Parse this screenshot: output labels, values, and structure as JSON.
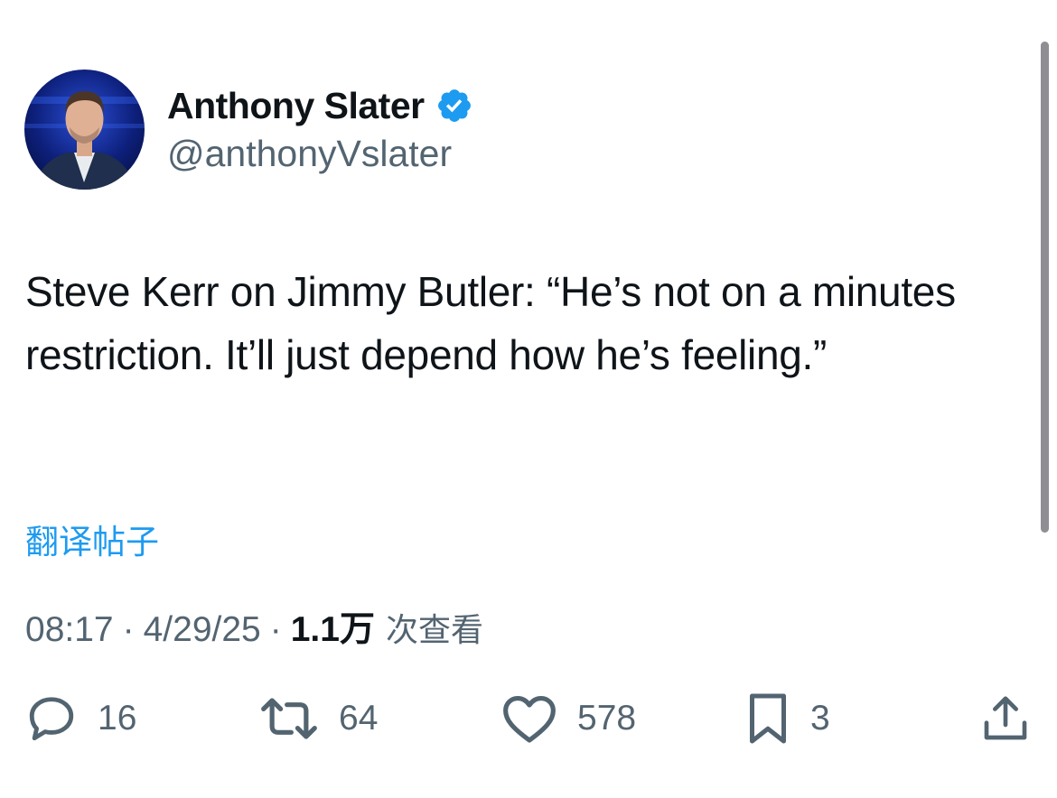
{
  "author": {
    "display_name": "Anthony Slater",
    "handle": "@anthonyVslater",
    "verified": true
  },
  "tweet": {
    "text": "Steve Kerr on Jimmy Butler: “He’s not on a minutes restriction. It’ll just depend how he’s feeling.”",
    "translate_label": "翻译帖子"
  },
  "meta": {
    "time": "08:17",
    "date": "4/29/25",
    "views_count": "1.1万",
    "views_label": "次查看"
  },
  "actions": {
    "replies": "16",
    "reposts": "64",
    "likes": "578",
    "bookmarks": "3"
  },
  "colors": {
    "accent": "#1d9bf0",
    "text": "#0f1419",
    "secondary": "#536471"
  },
  "icons": [
    "verified-badge-icon",
    "reply-icon",
    "retweet-icon",
    "like-icon",
    "bookmark-icon",
    "share-icon"
  ]
}
